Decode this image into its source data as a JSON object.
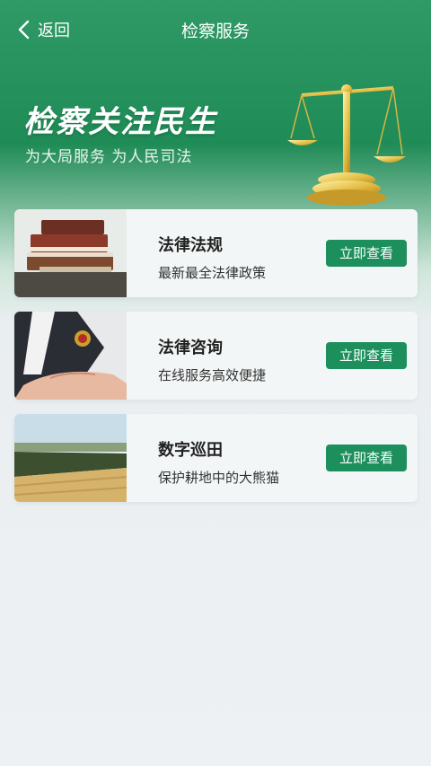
{
  "header": {
    "back_label": "返回",
    "title": "检察服务"
  },
  "banner": {
    "slogan": "检察关注民生",
    "subslogan": "为大局服务 为人民司法",
    "image_icon": "scales-of-justice-icon"
  },
  "cards": [
    {
      "title": "法律法规",
      "subtitle": "最新最全法律政策",
      "button": "立即查看",
      "thumb": "books-thumbnail"
    },
    {
      "title": "法律咨询",
      "subtitle": "在线服务高效便捷",
      "button": "立即查看",
      "thumb": "badge-handshake-thumbnail"
    },
    {
      "title": "数字巡田",
      "subtitle": "保护耕地中的大熊猫",
      "button": "立即查看",
      "thumb": "farmland-thumbnail"
    }
  ],
  "colors": {
    "accent": "#1c8f5d",
    "header_green": "#2f9a66",
    "page_bg": "#eef1f3"
  }
}
